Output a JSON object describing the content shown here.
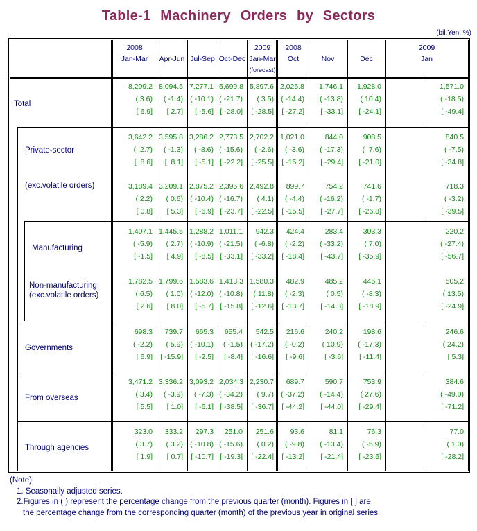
{
  "title": "Table-1  Machinery  Orders  by  Sectors",
  "unit": "(bil.Yen, %)",
  "columns": [
    {
      "line1": "2008",
      "line2": "Jan-Mar",
      "line3": ""
    },
    {
      "line1": "",
      "line2": "Apr-Jun",
      "line3": ""
    },
    {
      "line1": "",
      "line2": "Jul-Sep",
      "line3": ""
    },
    {
      "line1": "",
      "line2": "Oct-Dec",
      "line3": ""
    },
    {
      "line1": "2009",
      "line2": "Jan-Mar",
      "line3": "(forecast)"
    },
    {
      "line1": "2008",
      "line2": "Oct",
      "line3": ""
    },
    {
      "line1": "",
      "line2": "Nov",
      "line3": ""
    },
    {
      "line1": "",
      "line2": "Dec",
      "line3": ""
    },
    {
      "line1": "2009",
      "line2": "Jan",
      "line3": ""
    }
  ],
  "rows": [
    {
      "label": "Total",
      "value": [
        "8,209.2",
        "8,094.5",
        "7,277.1",
        "5,699.8",
        "5,897.6",
        "2,025.8",
        "1,746.1",
        "1,928.0",
        "1,571.0"
      ],
      "qoq": [
        "( 3.6)",
        "( -1.4)",
        "( -10.1)",
        "( -21.7)",
        "( 3.5)",
        "( -14.4)",
        "( -13.8)",
        "( 10.4)",
        "( -18.5)"
      ],
      "yoy": [
        "[ 6.9]",
        "[ 2.7]",
        "[ -5.6]",
        "[ -28.0]",
        "[ -28.5]",
        "[ -27.2]",
        "[ -33.1]",
        "[ -24.1]",
        "[ -49.4]"
      ]
    },
    {
      "label": "Private-sector",
      "value": [
        "3,642.2",
        "3,595.8",
        "3,286.2",
        "2,773.5",
        "2,702.2",
        "1,021.0",
        "844.0",
        "908.5",
        "840.5"
      ],
      "qoq": [
        "(  2.7)",
        "( -1.3)",
        "( -8.6)",
        "( -15.6)",
        "( -2.6)",
        "( -3.6)",
        "( -17.3)",
        "(  7.6)",
        "( -7.5)"
      ],
      "yoy": [
        "[  8.6]",
        "[  8.1]",
        "[ -5.1]",
        "[ -22.2]",
        "[ -25.5]",
        "[ -15.2]",
        "[ -29.4]",
        "[ -21.0]",
        "[ -34.8]"
      ]
    },
    {
      "label": "(exc.volatile orders)",
      "value": [
        "3,189.4",
        "3,209.1",
        "2,875.2",
        "2,395.6",
        "2,492.8",
        "899.7",
        "754.2",
        "741.6",
        "718.3"
      ],
      "qoq": [
        "( 2.2)",
        "( 0.6)",
        "( -10.4)",
        "( -16.7)",
        "( 4.1)",
        "( -4.4)",
        "( -16.2)",
        "( -1.7)",
        "( -3.2)"
      ],
      "yoy": [
        "[ 0.8]",
        "[ 5.3]",
        "[ -6.9]",
        "[ -23.7]",
        "[ -22.5]",
        "[ -15.5]",
        "[ -27.7]",
        "[ -26.8]",
        "[ -39.5]"
      ]
    },
    {
      "label": "Manufacturing",
      "value": [
        "1,407.1",
        "1,445.5",
        "1,288.2",
        "1,011.1",
        "942.3",
        "424.4",
        "283.4",
        "303.3",
        "220.2"
      ],
      "qoq": [
        "( -5.9)",
        "( 2.7)",
        "( -10.9)",
        "( -21.5)",
        "( -6.8)",
        "( -2.2)",
        "( -33.2)",
        "( 7.0)",
        "( -27.4)"
      ],
      "yoy": [
        "[ -1.5]",
        "[ 4.9]",
        "[ -8.5]",
        "[ -33.1]",
        "[ -33.2]",
        "[ -18.4]",
        "[ -43.7]",
        "[ -35.9]",
        "[ -56.7]"
      ]
    },
    {
      "label": "Non-manufacturing",
      "label2": "(exc.volatile orders)",
      "value": [
        "1,782.5",
        "1,799.6",
        "1,583.6",
        "1,413.3",
        "1,580.3",
        "482.9",
        "485.2",
        "445.1",
        "505.2"
      ],
      "qoq": [
        "( 6.5)",
        "( 1.0)",
        "( -12.0)",
        "( -10.8)",
        "( 11.8)",
        "( -2.3)",
        "( 0.5)",
        "( -8.3)",
        "( 13.5)"
      ],
      "yoy": [
        "[ 2.6]",
        "[ 8.0]",
        "[ -5.7]",
        "[ -15.8]",
        "[ -12.6]",
        "[ -13.7]",
        "[ -14.3]",
        "[ -18.9]",
        "[ -24.9]"
      ]
    },
    {
      "label": "Governments",
      "value": [
        "698.3",
        "739.7",
        "665.3",
        "655.4",
        "542.5",
        "216.6",
        "240.2",
        "198.6",
        "246.6"
      ],
      "qoq": [
        "( -2.2)",
        "( 5.9)",
        "( -10.1)",
        "( -1.5)",
        "( -17.2)",
        "( -0.2)",
        "( 10.9)",
        "( -17.3)",
        "( 24.2)"
      ],
      "yoy": [
        "[ 6.9]",
        "[ -15.9]",
        "[ -2.5]",
        "[ -8.4]",
        "[ -16.6]",
        "[ -9.6]",
        "[ -3.6]",
        "[ -11.4]",
        "[ 5.3]"
      ]
    },
    {
      "label": "From overseas",
      "value": [
        "3,471.2",
        "3,336.2",
        "3,093.2",
        "2,034.3",
        "2,230.7",
        "689.7",
        "590.7",
        "753.9",
        "384.6"
      ],
      "qoq": [
        "( 3.4)",
        "( -3.9)",
        "( -7.3)",
        "( -34.2)",
        "( 9.7)",
        "( -37.2)",
        "( -14.4)",
        "( 27.6)",
        "( -49.0)"
      ],
      "yoy": [
        "[ 5.5]",
        "[ 1.0]",
        "[ -6.1]",
        "[ -38.5]",
        "[ -36.7]",
        "[ -44.2]",
        "[ -44.0]",
        "[ -29.4]",
        "[ -71.2]"
      ]
    },
    {
      "label": "Through agencies",
      "value": [
        "323.0",
        "333.2",
        "297.3",
        "251.0",
        "251.6",
        "93.6",
        "81.1",
        "76.3",
        "77.0"
      ],
      "qoq": [
        "( 3.7)",
        "( 3.2)",
        "( -10.8)",
        "( -15.6)",
        "( 0.2)",
        "( -9.8)",
        "( -13.4)",
        "( -5.9)",
        "( 1.0)"
      ],
      "yoy": [
        "[ 1.9]",
        "[ 0.7]",
        "[ -10.7]",
        "[ -19.3]",
        "[ -22.4]",
        "[ -13.2]",
        "[ -21.4]",
        "[ -23.6]",
        "[ -28.2]"
      ]
    }
  ],
  "notes": {
    "heading": "(Note)",
    "items": [
      "1. Seasonally adjusted series.",
      "2.Figures in ( ) represent the percentage change from the previous quarter (month). Figures in [ ] are",
      "the percentage change from the corresponding quarter (month) of the previous year in original series."
    ]
  }
}
